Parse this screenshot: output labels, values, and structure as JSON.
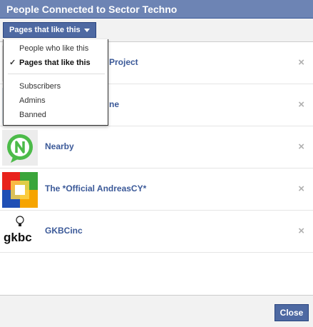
{
  "dialog": {
    "title": "People Connected to Sector Techno"
  },
  "filter": {
    "label": "Pages that like this"
  },
  "dropdown": {
    "items": [
      {
        "label": "People who like this",
        "checked": false
      },
      {
        "label": "Pages that like this",
        "checked": true
      },
      {
        "label": "Subscribers",
        "checked": false
      },
      {
        "label": "Admins",
        "checked": false
      },
      {
        "label": "Banned",
        "checked": false
      }
    ],
    "check_glyph": "✓"
  },
  "pages": [
    {
      "name": "Project",
      "thumb": "partial-icon"
    },
    {
      "name": "ne",
      "thumb": "partial-icon"
    },
    {
      "name": "Nearby",
      "thumb": "nearby-logo-icon"
    },
    {
      "name": "The *Official AndreasCY*",
      "thumb": "colorful-squares-icon"
    },
    {
      "name": "GKBCinc",
      "thumb": "gkbc-logo-icon",
      "logo_text": "gkbc"
    }
  ],
  "remove_glyph": "×",
  "footer": {
    "close_label": "Close"
  },
  "colors": {
    "header": "#6d84b4",
    "button": "#4e69a2",
    "link": "#3b5998"
  }
}
